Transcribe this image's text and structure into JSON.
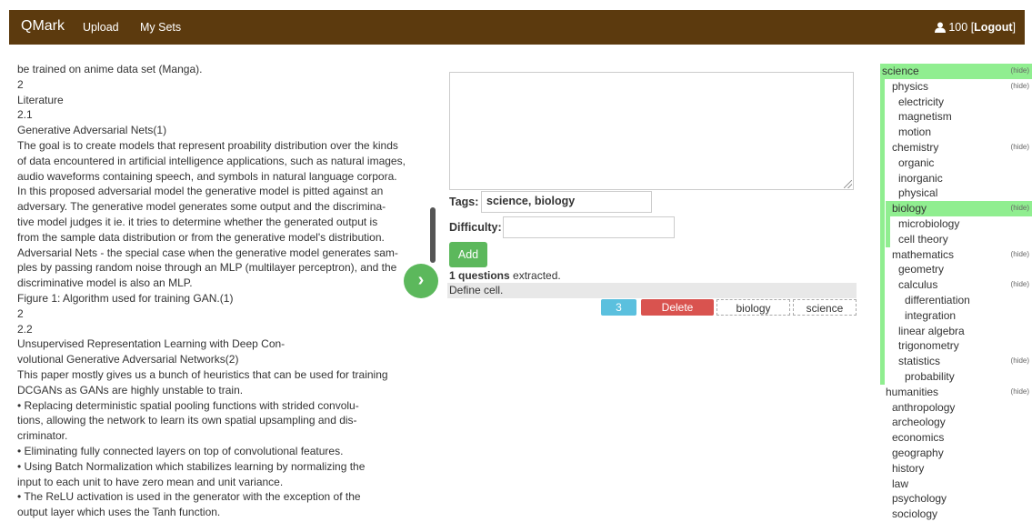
{
  "navbar": {
    "brand": "QMark",
    "links": [
      "Upload",
      "My Sets"
    ],
    "points": "100",
    "logout_prefix": "[",
    "logout_label": "Logout",
    "logout_suffix": "]"
  },
  "document": {
    "lines": [
      "be trained on anime data set (Manga).",
      "2",
      "Literature",
      "2.1",
      "Generative Adversarial Nets(1)",
      "The goal is to create models that represent proability distribution over the kinds",
      "of data encountered in artificial intelligence applications, such as natural images,",
      "audio waveforms containing speech, and symbols in natural language corpora.",
      "In this proposed adversarial model the generative model is pitted against an",
      "adversary. The generative model generates some output and the discrimina-",
      "tive model judges it ie. it tries to determine whether the generated output is",
      "from the sample data distribution or from the generative model's distribution.",
      "Adversarial Nets - the special case when the generative model generates sam-",
      "ples by passing random noise through an MLP (multilayer perceptron), and the",
      "discriminative model is also an MLP.",
      "Figure 1: Algorithm used for training GAN.(1)",
      "2",
      "2.2",
      "Unsupervised Representation Learning with Deep Con-",
      "volutional Generative Adversarial Networks(2)",
      "This paper mostly gives us a bunch of heuristics that can be used for training",
      "DCGANs as GANs are highly unstable to train.",
      "• Replacing deterministic spatial pooling functions with strided convolu-",
      "tions, allowing the network to learn its own spatial upsampling and dis-",
      "criminator.",
      "• Eliminating fully connected layers on top of convolutional features.",
      "• Using Batch Normalization which stabilizes learning by normalizing the",
      "input to each unit to have zero mean and unit variance.",
      "• The ReLU activation is used in the generator with the exception of the",
      "output layer which uses the Tanh function."
    ]
  },
  "next_button": {
    "icon": "chevron-right-icon",
    "glyph": "›"
  },
  "form": {
    "question_value": "",
    "tags_label": "Tags:",
    "tags_value": "science, biology",
    "difficulty_label": "Difficulty:",
    "difficulty_value": "",
    "add_label": "Add",
    "extracted_count": "1 questions",
    "extracted_suffix": " extracted."
  },
  "questions": [
    {
      "text": "Define cell.",
      "difficulty": "3",
      "delete_label": "Delete",
      "tags": [
        "biology",
        "science"
      ]
    }
  ],
  "tree": {
    "hide_label": "(hide)",
    "nodes": [
      "science",
      "physics",
      "electricity",
      "magnetism",
      "motion",
      "chemistry",
      "organic",
      "inorganic",
      "physical",
      "biology",
      "microbiology",
      "cell theory",
      "mathematics",
      "geometry",
      "calculus",
      "differentiation",
      "integration",
      "linear algebra",
      "trigonometry",
      "statistics",
      "probability",
      "humanities",
      "anthropology",
      "archeology",
      "economics",
      "geography",
      "history",
      "law",
      "psychology",
      "sociology"
    ]
  },
  "colors": {
    "navbar": "#5c3a0e",
    "success": "#5cb85c",
    "danger": "#d9534f",
    "info": "#5bc0de",
    "highlight": "#90ee90"
  }
}
